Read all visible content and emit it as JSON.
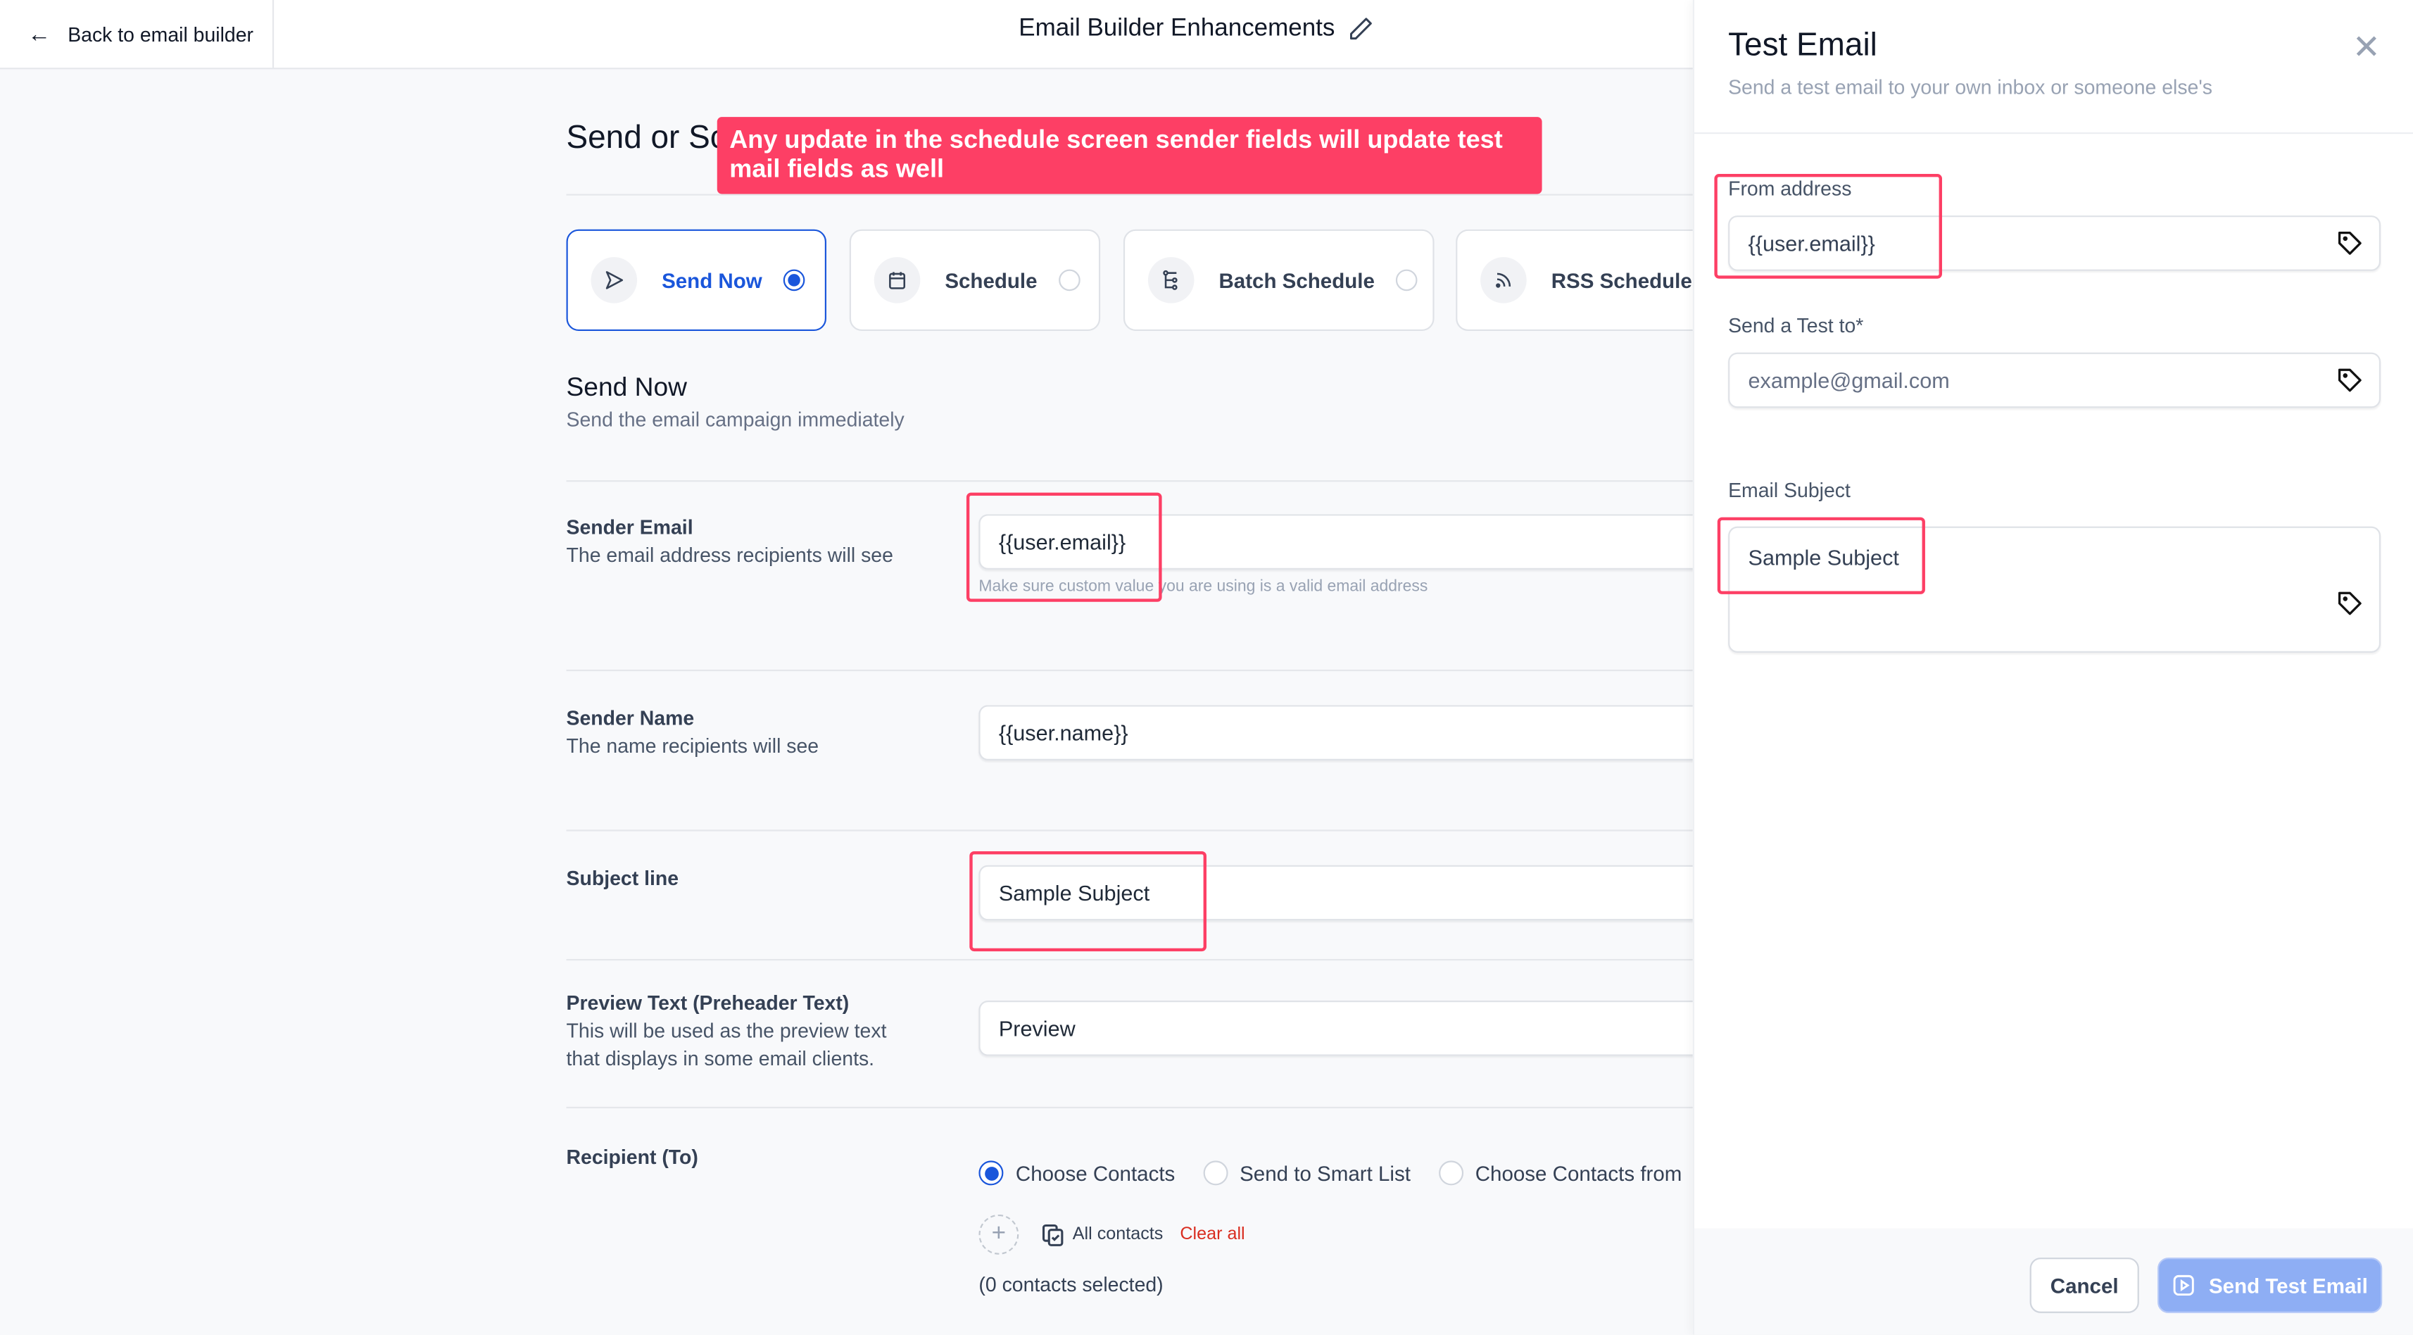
{
  "header": {
    "back_label": "Back to email builder",
    "title": "Email Builder Enhancements"
  },
  "main": {
    "heading": "Send or Schedule",
    "heading_visible": "Send or Sc",
    "annotation": "Any update in the schedule screen sender fields will update test mail fields as well",
    "options": [
      {
        "label": "Send Now",
        "icon": "send-icon",
        "selected": true
      },
      {
        "label": "Schedule",
        "icon": "calendar-icon",
        "selected": false
      },
      {
        "label": "Batch Schedule",
        "icon": "batch-icon",
        "selected": false
      },
      {
        "label": "RSS Schedule",
        "icon": "rss-icon",
        "selected": false
      }
    ],
    "section_title": "Send Now",
    "section_subtitle": "Send the email campaign immediately",
    "fields": {
      "sender_email": {
        "label": "Sender Email",
        "description": "The email address recipients will see",
        "value": "{{user.email}}",
        "hint": "Make sure custom value you are using is a valid email address"
      },
      "sender_name": {
        "label": "Sender Name",
        "description": "The name recipients will see",
        "value": "{{user.name}}"
      },
      "subject": {
        "label": "Subject line",
        "value": "Sample Subject"
      },
      "preview": {
        "label": "Preview Text (Preheader Text)",
        "description_line1": "This will be used as the preview text",
        "description_line2": "that displays in some email clients.",
        "value": "Preview"
      }
    },
    "recipient": {
      "label": "Recipient (To)",
      "options": [
        {
          "label": "Choose Contacts",
          "selected": true
        },
        {
          "label": "Send to Smart List",
          "selected": false
        },
        {
          "label": "Choose Contacts from",
          "selected": false
        }
      ],
      "all_contacts_label": "All contacts",
      "clear_all_label": "Clear all",
      "selected_count": "(0 contacts selected)"
    }
  },
  "drawer": {
    "title": "Test Email",
    "subtitle": "Send a test email to your own inbox or someone else's",
    "from_label": "From address",
    "from_value": "{{user.email}}",
    "to_label": "Send a Test to*",
    "to_placeholder": "example@gmail.com",
    "subject_label": "Email Subject",
    "subject_value": "Sample Subject",
    "cancel_label": "Cancel",
    "send_label": "Send Test Email"
  },
  "colors": {
    "accent": "#1a56db",
    "annotation": "#fd3f65",
    "danger": "#d92d20",
    "send_button_disabled": "#8eaef4"
  }
}
